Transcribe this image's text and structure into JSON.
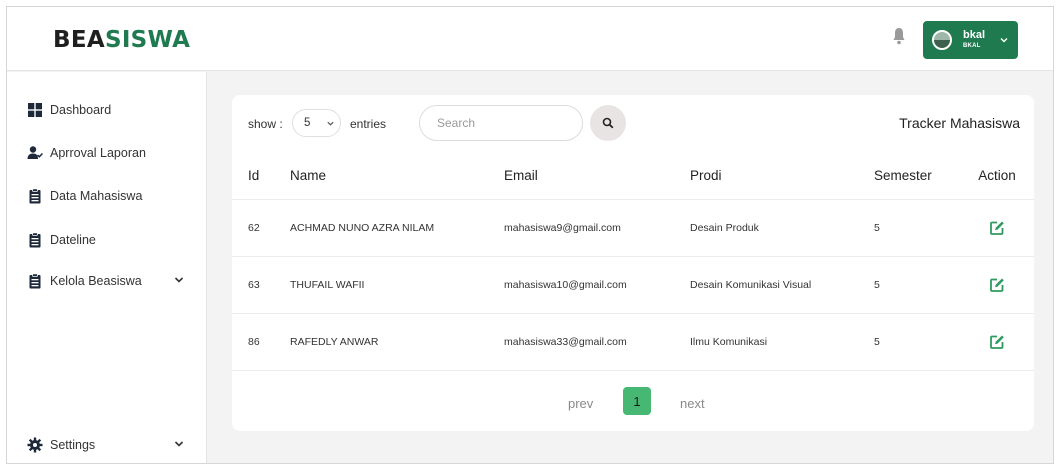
{
  "app": {
    "logo_part1": "BEA",
    "logo_part2": "SISWA",
    "accent_color": "#1f7a4f",
    "pagination_color": "#46b873"
  },
  "header": {
    "bell_icon": "bell-icon",
    "user": {
      "name": "bkal",
      "sub": "BKAL",
      "chevron_icon": "chevron-down-icon"
    }
  },
  "sidebar": {
    "items": [
      {
        "label": "Dashboard",
        "icon": "grid-icon"
      },
      {
        "label": "Aprroval Laporan",
        "icon": "user-check-icon"
      },
      {
        "label": "Data Mahasiswa",
        "icon": "clipboard-icon"
      },
      {
        "label": "Dateline",
        "icon": "clipboard-icon"
      },
      {
        "label": "Kelola Beasiswa",
        "icon": "clipboard-icon",
        "expandable": true
      }
    ],
    "settings": {
      "label": "Settings",
      "icon": "gear-icon",
      "expandable": true
    }
  },
  "main": {
    "show_label": "show :",
    "entries_value": "5",
    "entries_label": "entries",
    "search_placeholder": "Search",
    "title": "Tracker Mahasiswa",
    "table": {
      "headers": [
        "Id",
        "Name",
        "Email",
        "Prodi",
        "Semester",
        "Action"
      ],
      "rows": [
        {
          "id": "62",
          "name": "ACHMAD NUNO AZRA NILAM",
          "email": "mahasiswa9@gmail.com",
          "prodi": "Desain Produk",
          "semester": "5"
        },
        {
          "id": "63",
          "name": "THUFAIL WAFII",
          "email": "mahasiswa10@gmail.com",
          "prodi": "Desain Komunikasi Visual",
          "semester": "5"
        },
        {
          "id": "86",
          "name": "RAFEDLY ANWAR",
          "email": "mahasiswa33@gmail.com",
          "prodi": "Ilmu Komunikasi",
          "semester": "5"
        }
      ]
    },
    "pagination": {
      "prev": "prev",
      "current": "1",
      "next": "next"
    }
  }
}
